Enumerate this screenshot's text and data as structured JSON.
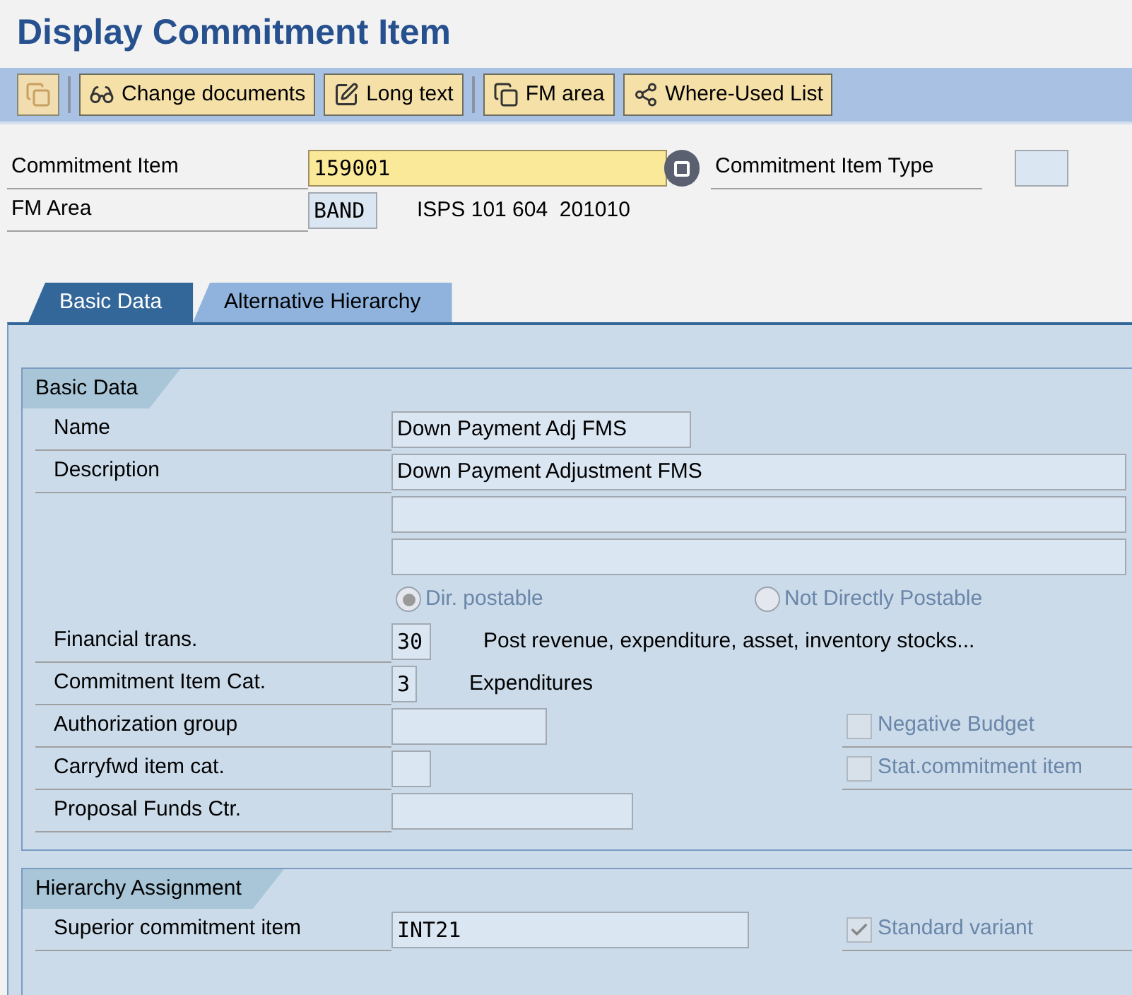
{
  "title": "Display Commitment Item",
  "toolbar": [
    {
      "label": "Change documents",
      "kind": "glasses"
    },
    {
      "label": "Long text",
      "kind": "pencil"
    },
    {
      "label": "FM area",
      "kind": "copy"
    },
    {
      "label": "Where-Used List",
      "kind": "tree"
    }
  ],
  "header": {
    "commitment_item": {
      "label": "Commitment Item",
      "value": "159001"
    },
    "item_type": {
      "label": "Commitment Item Type"
    },
    "fm_area": {
      "label": "FM Area",
      "value": "BAND",
      "text": "ISPS 101 604  201010"
    }
  },
  "tabs": [
    {
      "label": "Basic Data",
      "selected": true
    },
    {
      "label": "Alternative Hierarchy",
      "selected": false
    }
  ],
  "basic_data": {
    "title": "Basic Data",
    "name": {
      "label": "Name",
      "value": "Down Payment Adj FMS"
    },
    "description": {
      "label": "Description",
      "value": "Down Payment Adjustment FMS"
    },
    "radios": [
      {
        "label": "Dir. postable",
        "selected": true,
        "disabled": true
      },
      {
        "label": "Not Directly Postable",
        "selected": false,
        "disabled": true
      }
    ],
    "fields": [
      {
        "label": "Financial trans.",
        "value": "30",
        "text": "Post revenue, expenditure, asset, inventory stocks..."
      },
      {
        "label": "Commitment Item Cat.",
        "value": "3",
        "text": "Expenditures"
      },
      {
        "label": "Authorization group",
        "checkbox": {
          "label": "Negative Budget",
          "checked": false,
          "disabled": true
        }
      },
      {
        "label": "Carryfwd item cat.",
        "checkbox": {
          "label": "Stat.commitment item",
          "checked": false,
          "disabled": true
        }
      },
      {
        "label": "Proposal Funds Ctr."
      }
    ]
  },
  "hierarchy": {
    "title": "Hierarchy Assignment",
    "superior": {
      "label": "Superior commitment item",
      "value": "INT21"
    },
    "standard_variant": {
      "label": "Standard variant",
      "checked": true,
      "disabled": true
    }
  }
}
